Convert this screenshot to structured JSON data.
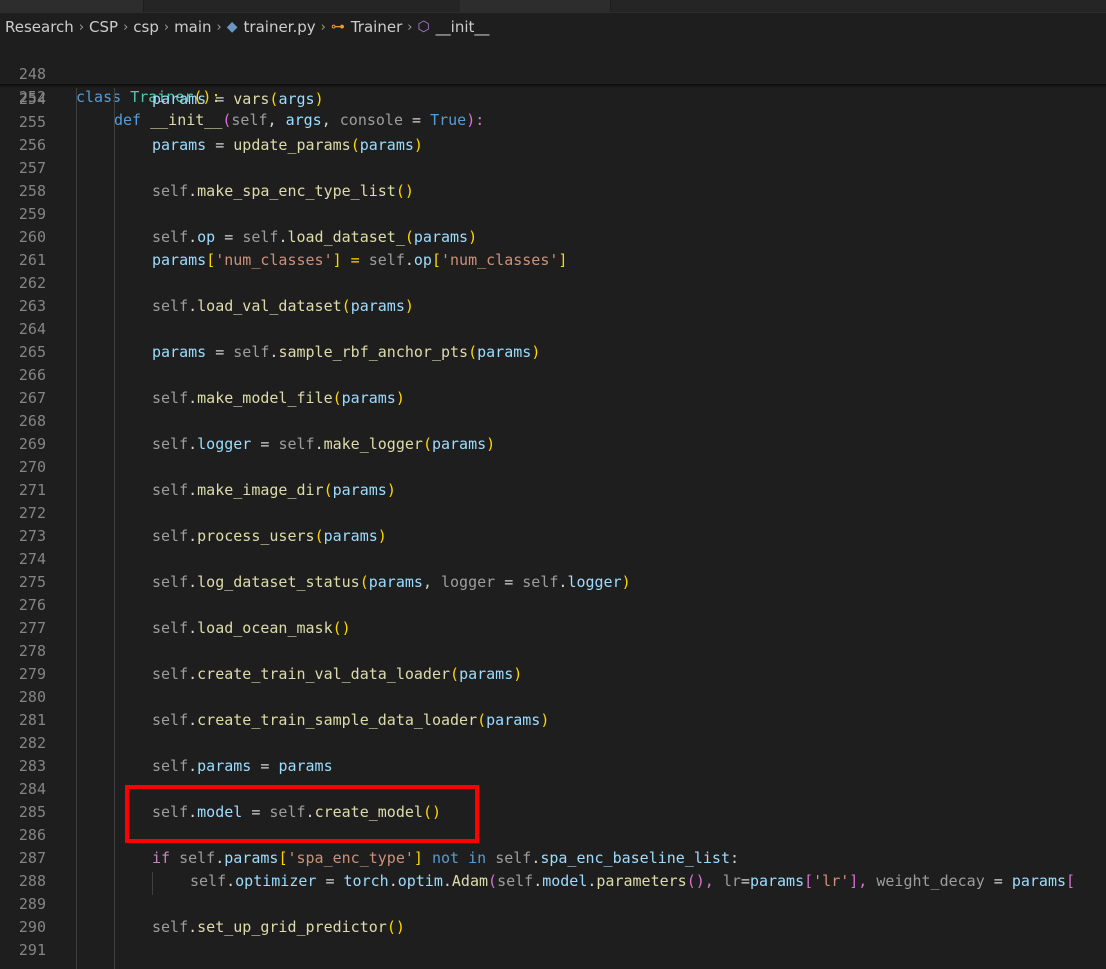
{
  "breadcrumb": {
    "items": [
      "Research",
      "CSP",
      "csp",
      "main",
      "trainer.py",
      "Trainer",
      "__init__"
    ]
  },
  "sticky": {
    "line1_no": "248",
    "line2_no": "252",
    "class_kw": "class",
    "class_name": "Trainer",
    "class_tail": "():",
    "def_kw": "def",
    "def_name": "__init__",
    "def_open": "(",
    "def_self": "self",
    "def_comma1": ", ",
    "def_args": "args",
    "def_comma2": ", ",
    "def_console": "console",
    "def_eq": " = ",
    "def_true": "True",
    "def_close": "):"
  },
  "lines": [
    {
      "no": "254"
    },
    {
      "no": "255"
    },
    {
      "no": "256"
    },
    {
      "no": "257"
    },
    {
      "no": "258"
    },
    {
      "no": "259"
    },
    {
      "no": "260"
    },
    {
      "no": "261"
    },
    {
      "no": "262"
    },
    {
      "no": "263"
    },
    {
      "no": "264"
    },
    {
      "no": "265"
    },
    {
      "no": "266"
    },
    {
      "no": "267"
    },
    {
      "no": "268"
    },
    {
      "no": "269"
    },
    {
      "no": "270"
    },
    {
      "no": "271"
    },
    {
      "no": "272"
    },
    {
      "no": "273"
    },
    {
      "no": "274"
    },
    {
      "no": "275"
    },
    {
      "no": "276"
    },
    {
      "no": "277"
    },
    {
      "no": "278"
    },
    {
      "no": "279"
    },
    {
      "no": "280"
    },
    {
      "no": "281"
    },
    {
      "no": "282"
    },
    {
      "no": "283"
    },
    {
      "no": "284"
    },
    {
      "no": "285"
    },
    {
      "no": "286"
    },
    {
      "no": "287"
    },
    {
      "no": "288"
    },
    {
      "no": "289"
    },
    {
      "no": "290"
    },
    {
      "no": "291"
    }
  ],
  "code": {
    "l254": [
      "params",
      " = ",
      "vars",
      "(",
      "args",
      ")"
    ],
    "l256": [
      "params",
      " = ",
      "update_params",
      "(",
      "params",
      ")"
    ],
    "l258": [
      "self",
      ".",
      "make_spa_enc_type_list",
      "()"
    ],
    "l260": [
      "self",
      ".",
      "op",
      " = ",
      "self",
      ".",
      "load_dataset_",
      "(",
      "params",
      ")"
    ],
    "l261": [
      "params",
      "[",
      "'num_classes'",
      "] = ",
      "self",
      ".",
      "op",
      "[",
      "'num_classes'",
      "]"
    ],
    "l263": [
      "self",
      ".",
      "load_val_dataset",
      "(",
      "params",
      ")"
    ],
    "l265": [
      "params",
      " = ",
      "self",
      ".",
      "sample_rbf_anchor_pts",
      "(",
      "params",
      ")"
    ],
    "l267": [
      "self",
      ".",
      "make_model_file",
      "(",
      "params",
      ")"
    ],
    "l269": [
      "self",
      ".",
      "logger",
      " = ",
      "self",
      ".",
      "make_logger",
      "(",
      "params",
      ")"
    ],
    "l271": [
      "self",
      ".",
      "make_image_dir",
      "(",
      "params",
      ")"
    ],
    "l273": [
      "self",
      ".",
      "process_users",
      "(",
      "params",
      ")"
    ],
    "l275": [
      "self",
      ".",
      "log_dataset_status",
      "(",
      "params",
      ", ",
      "logger",
      " = ",
      "self",
      ".",
      "logger",
      ")"
    ],
    "l277": [
      "self",
      ".",
      "load_ocean_mask",
      "()"
    ],
    "l279": [
      "self",
      ".",
      "create_train_val_data_loader",
      "(",
      "params",
      ")"
    ],
    "l281": [
      "self",
      ".",
      "create_train_sample_data_loader",
      "(",
      "params",
      ")"
    ],
    "l283": [
      "self",
      ".",
      "params",
      " = ",
      "params"
    ],
    "l285": [
      "self",
      ".",
      "model",
      " = ",
      "self",
      ".",
      "create_model",
      "()"
    ],
    "l287": [
      "if ",
      "self",
      ".",
      "params",
      "[",
      "'spa_enc_type'",
      "] ",
      "not",
      " ",
      "in",
      " ",
      "self",
      ".",
      "spa_enc_baseline_list",
      ":"
    ],
    "l288": [
      "self",
      ".",
      "optimizer",
      " = ",
      "torch",
      ".",
      "optim",
      ".",
      "Adam",
      "(",
      "self",
      ".",
      "model",
      ".",
      "parameters",
      "(), ",
      "lr",
      "=",
      "params",
      "[",
      "'lr'",
      "], ",
      "weight_decay",
      " = ",
      "params",
      "["
    ],
    "l290": [
      "self",
      ".",
      "set_up_grid_predictor",
      "()"
    ]
  }
}
